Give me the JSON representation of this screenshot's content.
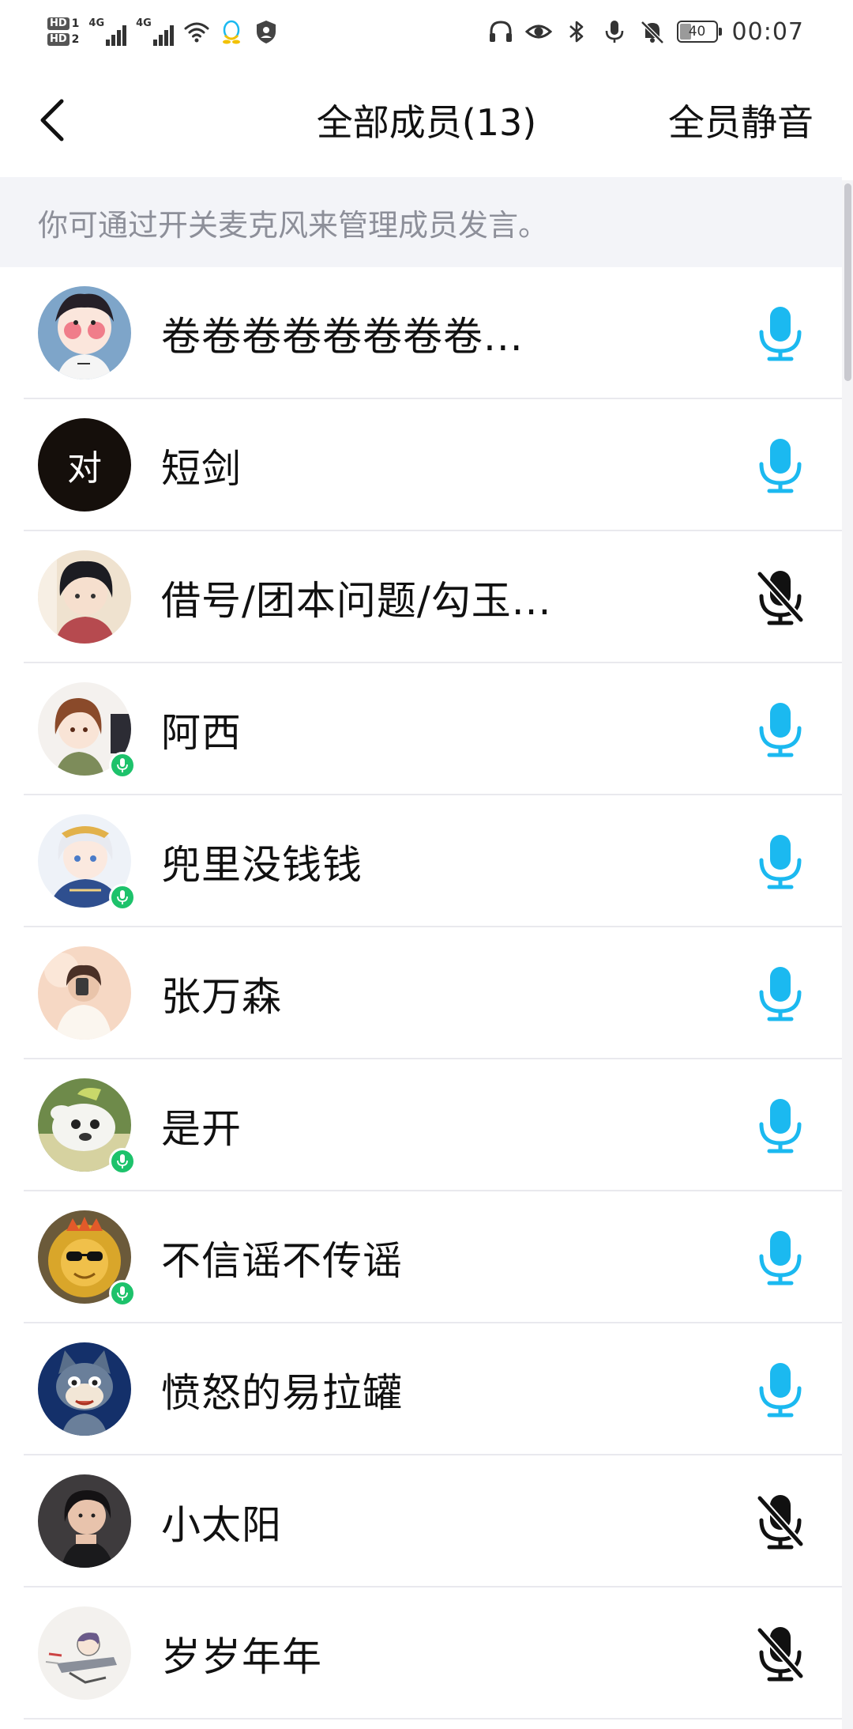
{
  "status_bar": {
    "hd1": "HD",
    "hd1_slot": "1",
    "hd2": "HD",
    "hd2_slot": "2",
    "net1": "4G",
    "net2": "4G",
    "battery": "40",
    "time": "00:07",
    "icons_left": [
      "signal-icon",
      "signal-icon",
      "wifi-icon",
      "qq-icon",
      "shield-icon"
    ],
    "icons_right": [
      "headphones-icon",
      "eye-icon",
      "bluetooth-icon",
      "microphone-icon",
      "bell-off-icon",
      "battery-icon"
    ]
  },
  "nav": {
    "title": "全部成员(13)",
    "action": "全员静音",
    "back_icon": "chevron-left-icon"
  },
  "hint": "你可通过开关麦克风来管理成员发言。",
  "colors": {
    "mic_on": "#1bb9f0",
    "mic_off": "#111111",
    "speaking_badge": "#1dc26b",
    "hint_bg": "#f3f4f8",
    "hint_text": "#8d8f99"
  },
  "members": [
    {
      "name": "卷卷卷卷卷卷卷卷...",
      "avatar": "anime-girl-avatar",
      "speaking": false,
      "mic": "on"
    },
    {
      "name": "短剑",
      "avatar_text": "对",
      "avatar": "text-avatar",
      "speaking": false,
      "mic": "on"
    },
    {
      "name": "借号/团本问题/勾玉...",
      "avatar": "anime-boy-avatar",
      "speaking": false,
      "mic": "off"
    },
    {
      "name": "阿西",
      "avatar": "anime-girl-avatar",
      "speaking": true,
      "mic": "on"
    },
    {
      "name": "兜里没钱钱",
      "avatar": "anime-girl-avatar",
      "speaking": true,
      "mic": "on"
    },
    {
      "name": "张万森",
      "avatar": "photo-avatar",
      "speaking": false,
      "mic": "on"
    },
    {
      "name": "是开",
      "avatar": "cartoon-dog-avatar",
      "speaking": true,
      "mic": "on"
    },
    {
      "name": "不信谣不传谣",
      "avatar": "golden-statue-avatar",
      "speaking": true,
      "mic": "on"
    },
    {
      "name": "愤怒的易拉罐",
      "avatar": "cartoon-cat-avatar",
      "speaking": false,
      "mic": "on"
    },
    {
      "name": "小太阳",
      "avatar": "photo-avatar",
      "speaking": false,
      "mic": "off"
    },
    {
      "name": "岁岁年年",
      "avatar": "sketch-avatar",
      "speaking": false,
      "mic": "off"
    }
  ]
}
